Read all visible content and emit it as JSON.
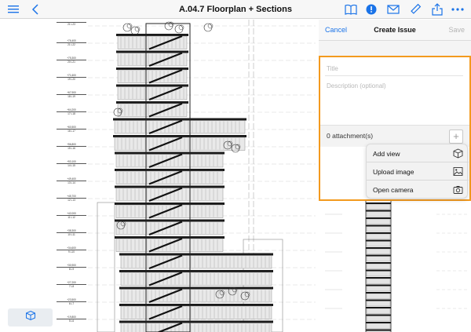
{
  "toolbar": {
    "title": "A.04.7 Floorplan + Sections",
    "left_icons": [
      "list-icon",
      "back-chevron-icon"
    ],
    "right_icons": [
      "book-icon",
      "issue-badge-icon",
      "mail-icon",
      "ruler-icon",
      "share-icon",
      "more-icon"
    ],
    "accent_color": "#1a73e8"
  },
  "level_markers": [
    {
      "top": "",
      "bottom": "21 L23",
      "highlight": false
    },
    {
      "top": "+76,400",
      "bottom": "21 L22",
      "highlight": false
    },
    {
      "top": "+75,300",
      "bottom": "20 L21",
      "highlight": true
    },
    {
      "top": "+71,600",
      "bottom": "19 L20",
      "highlight": false
    },
    {
      "top": "+67,900",
      "bottom": "18 L19",
      "highlight": false
    },
    {
      "top": "+64,200",
      "bottom": "17 L18",
      "highlight": false
    },
    {
      "top": "+60,500",
      "bottom": "16 L17",
      "highlight": false
    },
    {
      "top": "+56,800",
      "bottom": "15 L16",
      "highlight": false
    },
    {
      "top": "+53,100",
      "bottom": "14 L15",
      "highlight": false
    },
    {
      "top": "+49,400",
      "bottom": "13 L14",
      "highlight": false
    },
    {
      "top": "+45,700",
      "bottom": "12 L13",
      "highlight": true
    },
    {
      "top": "+42,000",
      "bottom": "11 L12",
      "highlight": false
    },
    {
      "top": "+38,300",
      "bottom": "10 L11",
      "highlight": false
    },
    {
      "top": "+34,600",
      "bottom": "9 L10",
      "highlight": false
    },
    {
      "top": "+30,900",
      "bottom": "8 L9",
      "highlight": false
    },
    {
      "top": "+27,200",
      "bottom": "7 L8",
      "highlight": false
    },
    {
      "top": "+23,500",
      "bottom": "6 L7",
      "highlight": true
    },
    {
      "top": "+19,800",
      "bottom": "5 L6",
      "highlight": false
    }
  ],
  "issue_panel": {
    "cancel_label": "Cancel",
    "title": "Create Issue",
    "save_label": "Save",
    "title_placeholder": "Title",
    "description_placeholder": "Description (optional)",
    "attachments_label": "0 attachment(s)",
    "add_attachment_symbol": "+",
    "highlight_color": "#f39a1e"
  },
  "attachment_menu": {
    "items": [
      {
        "label": "Add view",
        "icon": "cube-icon"
      },
      {
        "label": "Upload image",
        "icon": "image-icon"
      },
      {
        "label": "Open camera",
        "icon": "camera-icon"
      }
    ]
  },
  "view_button": {
    "icon": "3d-cube-icon"
  }
}
